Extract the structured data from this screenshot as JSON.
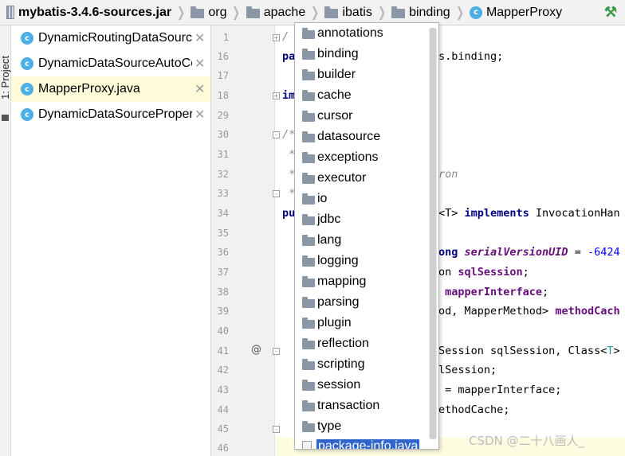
{
  "breadcrumb": {
    "items": [
      {
        "label": "mybatis-3.4.6-sources.jar",
        "icon": "jar-icon"
      },
      {
        "label": "org",
        "icon": "folder-icon"
      },
      {
        "label": "apache",
        "icon": "folder-icon"
      },
      {
        "label": "ibatis",
        "icon": "folder-icon"
      },
      {
        "label": "binding",
        "icon": "folder-icon"
      },
      {
        "label": "MapperProxy",
        "icon": "class-icon"
      }
    ]
  },
  "tool_window": {
    "label": "1: Project"
  },
  "open_files": [
    {
      "name": "DynamicRoutingDataSource.java",
      "active": false
    },
    {
      "name": "DynamicDataSourceAutoConfiguration.java",
      "active": false
    },
    {
      "name": "MapperProxy.java",
      "active": true
    },
    {
      "name": "DynamicDataSourceProperties.java",
      "active": false
    }
  ],
  "gutter": {
    "line_numbers": [
      "1",
      "16",
      "17",
      "18",
      "29",
      "30",
      "31",
      "32",
      "33",
      "34",
      "35",
      "36",
      "37",
      "38",
      "39",
      "40",
      "41",
      "42",
      "43",
      "44",
      "45",
      "46"
    ],
    "at_marker": "@"
  },
  "code_lines": [
    {
      "text": "/",
      "style": "cmt"
    },
    {
      "text": "pa",
      "style": "kw"
    },
    {
      "text": "",
      "style": "plain"
    },
    {
      "text": "im",
      "style": "kw"
    },
    {
      "text": "",
      "style": "plain"
    },
    {
      "text": "/*",
      "style": "cmt"
    },
    {
      "text": " *",
      "style": "cmt"
    },
    {
      "text": " *",
      "style": "cmt"
    },
    {
      "text": " *",
      "style": "cmt"
    },
    {
      "text": "pu",
      "style": "kw"
    },
    {
      "text": "",
      "style": "plain"
    },
    {
      "text": "",
      "style": "plain"
    },
    {
      "text": "",
      "style": "plain"
    },
    {
      "text": "",
      "style": "plain"
    },
    {
      "text": "",
      "style": "plain"
    },
    {
      "text": "",
      "style": "plain"
    },
    {
      "text": "",
      "style": "plain"
    },
    {
      "text": "",
      "style": "plain"
    },
    {
      "text": "",
      "style": "plain"
    },
    {
      "text": "",
      "style": "plain"
    },
    {
      "text": "",
      "style": "plain"
    },
    {
      "text": "",
      "style": "plain"
    }
  ],
  "code_right": {
    "line16": "s.binding;",
    "line32": "ron",
    "line34_a": "<T> ",
    "line34_b": "implements",
    "line34_c": " InvocationHan",
    "line36_a": "ong ",
    "line36_b": "serialVersionUID",
    "line36_c": " = ",
    "line36_d": "-6424",
    "line37_a": "on ",
    "line37_b": "sqlSession",
    "line37_c": ";",
    "line38_a": " ",
    "line38_b": "mapperInterface",
    "line38_c": ";",
    "line39_a": "od, MapperMethod> ",
    "line39_b": "methodCach",
    "line41_a": "Session sqlSession, Class<",
    "line41_b": "T",
    "line41_c": ">",
    "line42": "lSession;",
    "line43": " = mapperInterface;",
    "line44": "ethodCache;"
  },
  "package_popup": {
    "items": [
      "annotations",
      "binding",
      "builder",
      "cache",
      "cursor",
      "datasource",
      "exceptions",
      "executor",
      "io",
      "jdbc",
      "lang",
      "logging",
      "mapping",
      "parsing",
      "plugin",
      "reflection",
      "scripting",
      "session",
      "transaction",
      "type"
    ],
    "selected_file": "package-info.java"
  },
  "watermark": "CSDN @二十八画人_",
  "colors": {
    "selection": "#2f65ca",
    "active_file": "#fefcd8",
    "keyword": "#000080",
    "field": "#660e7a"
  }
}
